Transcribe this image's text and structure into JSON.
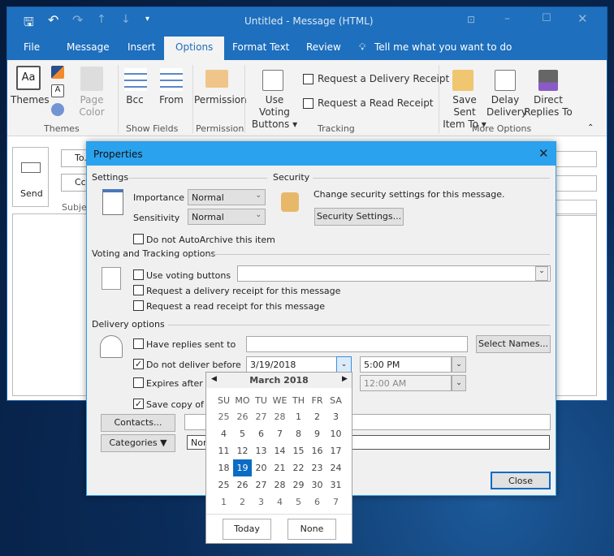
{
  "window": {
    "title": "Untitled  -  Message (HTML)"
  },
  "tabs": [
    {
      "label": "File"
    },
    {
      "label": "Message"
    },
    {
      "label": "Insert"
    },
    {
      "label": "Options",
      "active": true
    },
    {
      "label": "Format Text"
    },
    {
      "label": "Review"
    }
  ],
  "tell_me": "Tell me what you want to do",
  "ribbon": {
    "themes": "Themes",
    "page_color_1": "Page",
    "page_color_2": "Color",
    "bcc": "Bcc",
    "from": "From",
    "permission": "Permission",
    "voting_1": "Use Voting",
    "voting_2": "Buttons",
    "delivery_receipt": "Request a Delivery Receipt",
    "read_receipt": "Request a Read Receipt",
    "save_sent_1": "Save Sent",
    "save_sent_2": "Item To",
    "delay_1": "Delay",
    "delay_2": "Delivery",
    "direct_1": "Direct",
    "direct_2": "Replies To",
    "groups": {
      "themes": "Themes",
      "show_fields": "Show Fields",
      "permission": "Permission",
      "tracking": "Tracking",
      "more_options": "More Options"
    }
  },
  "compose": {
    "send": "Send",
    "to": "To...",
    "cc": "Cc...",
    "subject": "Subject"
  },
  "dialog": {
    "title": "Properties",
    "settings": "Settings",
    "importance_label": "Importance",
    "importance": "Normal",
    "sensitivity_label": "Sensitivity",
    "sensitivity": "Normal",
    "autoarchive": "Do not AutoArchive this item",
    "security": "Security",
    "security_text": "Change security settings for this message.",
    "security_button": "Security Settings...",
    "voting_section": "Voting and Tracking options",
    "use_voting": "Use voting buttons",
    "voting_value": "",
    "delivery_receipt": "Request a delivery receipt for this message",
    "read_receipt": "Request a read receipt for this message",
    "delivery_section": "Delivery options",
    "replies": "Have replies sent to",
    "replies_value": "",
    "select_names": "Select Names...",
    "deliver_before": "Do not deliver before",
    "deliver_date": "3/19/2018",
    "deliver_time": "5:00 PM",
    "expires": "Expires after",
    "expires_time": "12:00 AM",
    "save_copy": "Save copy of sent message",
    "contacts": "Contacts...",
    "contacts_value": "",
    "categories": "Categories",
    "categories_value": "None",
    "close": "Close",
    "checked": {
      "autoarchive": false,
      "use_voting": false,
      "delivery_receipt": false,
      "read_receipt": false,
      "replies": false,
      "deliver_before": true,
      "expires": false,
      "save_copy": true
    }
  },
  "calendar": {
    "month": "March 2018",
    "days": [
      "SU",
      "MO",
      "TU",
      "WE",
      "TH",
      "FR",
      "SA"
    ],
    "weeks": [
      [
        "25",
        "26",
        "27",
        "28",
        "1",
        "2",
        "3"
      ],
      [
        "4",
        "5",
        "6",
        "7",
        "8",
        "9",
        "10"
      ],
      [
        "11",
        "12",
        "13",
        "14",
        "15",
        "16",
        "17"
      ],
      [
        "18",
        "19",
        "20",
        "21",
        "22",
        "23",
        "24"
      ],
      [
        "25",
        "26",
        "27",
        "28",
        "29",
        "30",
        "31"
      ],
      [
        "1",
        "2",
        "3",
        "4",
        "5",
        "6",
        "7"
      ]
    ],
    "selected": "19",
    "today": "Today",
    "none": "None"
  },
  "colors": {
    "accent": "#1e6fbd",
    "dialog_title": "#2ba2ee",
    "selected_day": "#0a6cc4"
  }
}
